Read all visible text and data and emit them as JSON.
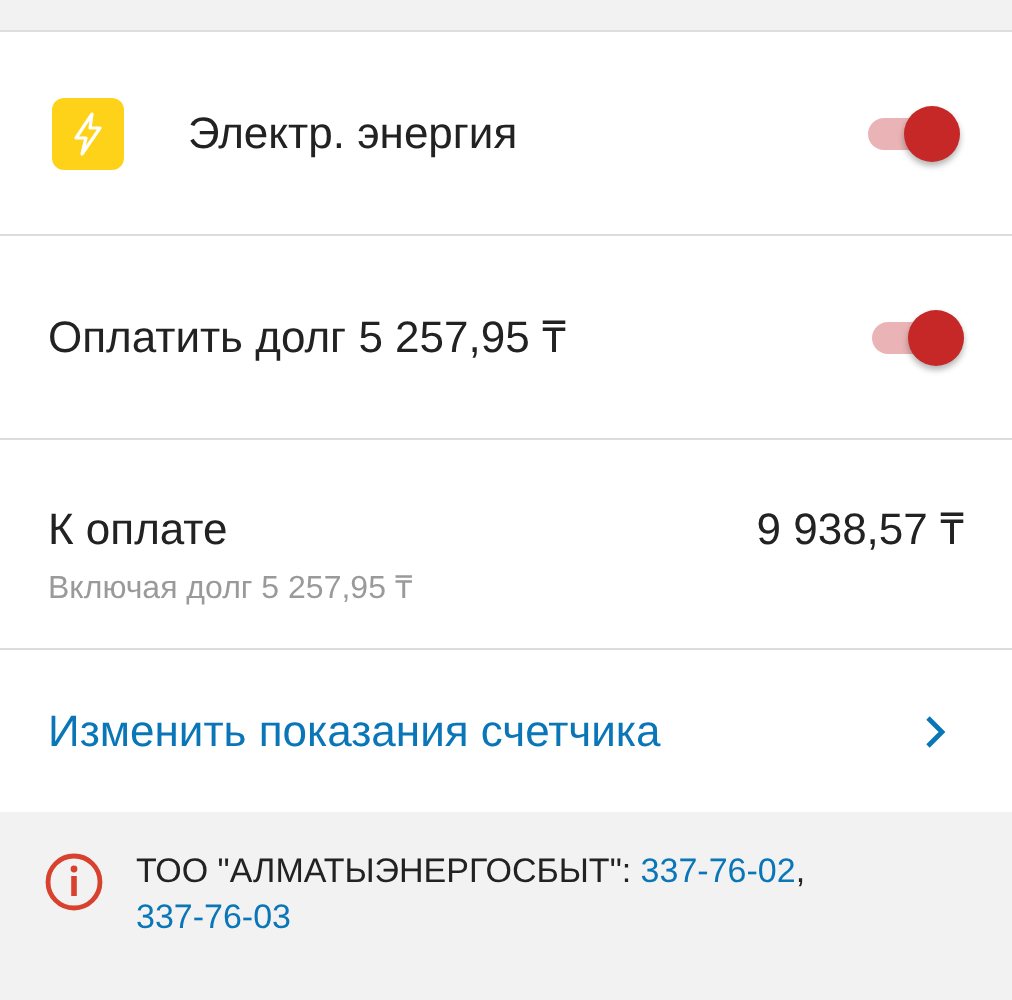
{
  "service": {
    "label": "Электр. энергия",
    "on": true
  },
  "debt_toggle": {
    "label": "Оплатить долг 5 257,95 ₸",
    "on": true
  },
  "total": {
    "label": "К оплате",
    "amount": "9 938,57 ₸",
    "note": "Включая долг 5 257,95 ₸"
  },
  "meter_link": {
    "label": "Изменить показания счетчика"
  },
  "info": {
    "segments": [
      {
        "kind": "text",
        "text": "ТОО \"АЛМАТЫЭНЕРГОСБЫТ\": "
      },
      {
        "kind": "link",
        "text": "337-76-02"
      },
      {
        "kind": "text",
        "text": ", "
      },
      {
        "kind": "link",
        "text": "337-76-03"
      }
    ]
  }
}
